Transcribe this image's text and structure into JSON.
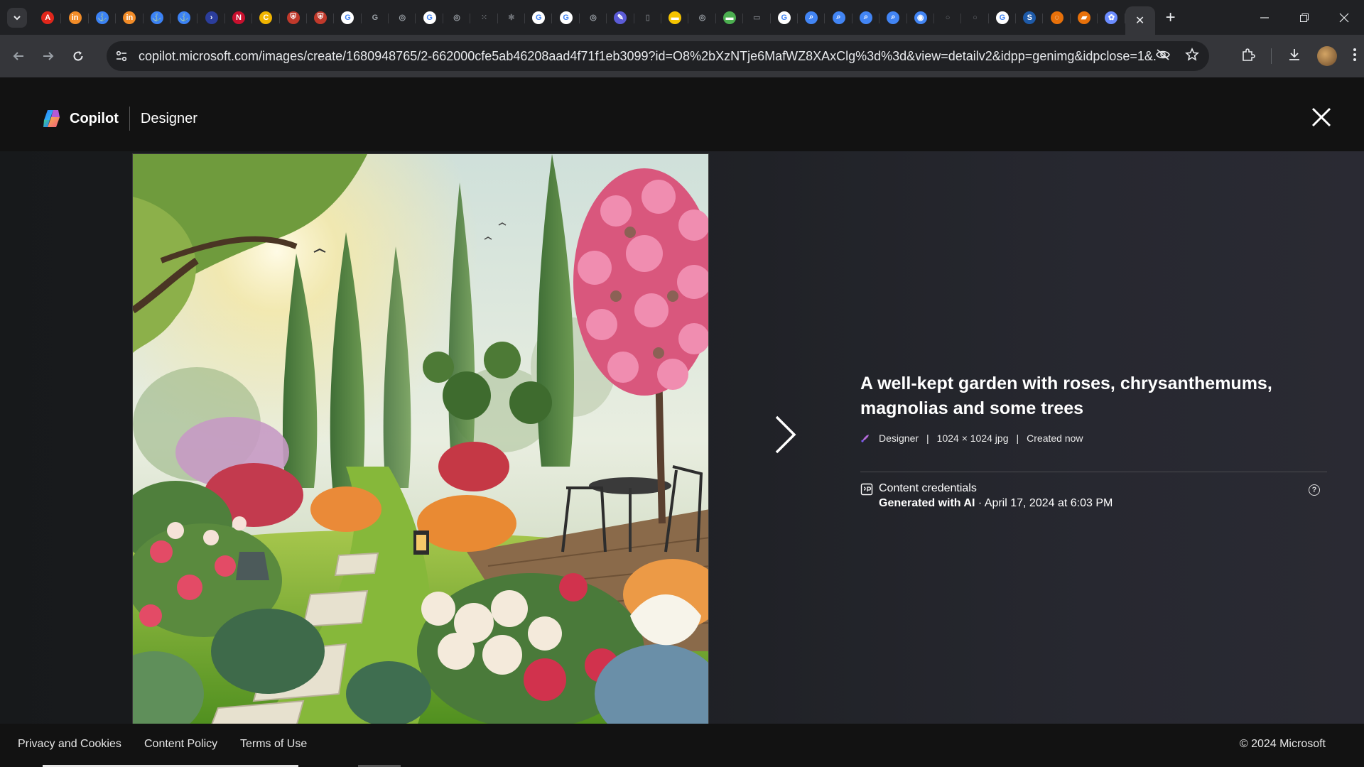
{
  "browser": {
    "url": "copilot.microsoft.com/images/create/1680948765/2-662000cfe5ab46208aad4f71f1eb3099?id=O8%2bXzNTje6MafWZ8XAxClg%3d%3d&view=detailv2&idpp=genimg&idpclose=1&...",
    "tab_favicons": [
      {
        "icon": "acrobat-icon",
        "color": "#e0261b",
        "glyph": "A"
      },
      {
        "icon": "app-icon",
        "color": "#f28c28",
        "glyph": "in"
      },
      {
        "icon": "anchor-icon",
        "color": "#3b82f6",
        "glyph": "⚓"
      },
      {
        "icon": "app-icon",
        "color": "#f28c28",
        "glyph": "in"
      },
      {
        "icon": "anchor-icon",
        "color": "#3b82f6",
        "glyph": "⚓"
      },
      {
        "icon": "anchor-icon",
        "color": "#3b82f6",
        "glyph": "⚓"
      },
      {
        "icon": "powershell-icon",
        "color": "#2b3d9b",
        "glyph": "›"
      },
      {
        "icon": "n-icon",
        "color": "#c8102e",
        "glyph": "N"
      },
      {
        "icon": "c-icon",
        "color": "#f0b400",
        "glyph": "C"
      },
      {
        "icon": "shield-icon",
        "color": "#c0392b",
        "glyph": "⛨"
      },
      {
        "icon": "shield-icon",
        "color": "#c0392b",
        "glyph": "⛨"
      },
      {
        "icon": "google-icon",
        "color": "#ffffff",
        "glyph": "G"
      },
      {
        "icon": "g-icon",
        "color": "#9aa0a6",
        "glyph": "G"
      },
      {
        "icon": "globe-icon",
        "color": "#9aa0a6",
        "glyph": "◎"
      },
      {
        "icon": "google-icon",
        "color": "#ffffff",
        "glyph": "G"
      },
      {
        "icon": "globe-icon",
        "color": "#9aa0a6",
        "glyph": "◎"
      },
      {
        "icon": "dots-icon",
        "color": "#3c3d41",
        "glyph": "⁙"
      },
      {
        "icon": "grid-icon",
        "color": "#3c3d41",
        "glyph": "✱"
      },
      {
        "icon": "google-icon",
        "color": "#ffffff",
        "glyph": "G"
      },
      {
        "icon": "google-icon",
        "color": "#ffffff",
        "glyph": "G"
      },
      {
        "icon": "globe-icon",
        "color": "#9aa0a6",
        "glyph": "◎"
      },
      {
        "icon": "copilot-icon",
        "color": "#5b5bd6",
        "glyph": "✎"
      },
      {
        "icon": "page-icon",
        "color": "#3c3d41",
        "glyph": "▯"
      },
      {
        "icon": "note-icon",
        "color": "#f5c400",
        "glyph": "▬"
      },
      {
        "icon": "globe-icon",
        "color": "#9aa0a6",
        "glyph": "◎"
      },
      {
        "icon": "bar-icon",
        "color": "#4caf50",
        "glyph": "▬"
      },
      {
        "icon": "blank-icon",
        "color": "#3c3d41",
        "glyph": "▭"
      },
      {
        "icon": "google-icon",
        "color": "#ffffff",
        "glyph": "G"
      },
      {
        "icon": "search-icon",
        "color": "#4285f4",
        "glyph": "⌕"
      },
      {
        "icon": "search-icon",
        "color": "#4285f4",
        "glyph": "⌕"
      },
      {
        "icon": "search-icon",
        "color": "#4285f4",
        "glyph": "⌕"
      },
      {
        "icon": "search-icon",
        "color": "#4285f4",
        "glyph": "⌕"
      },
      {
        "icon": "lens-icon",
        "color": "#4285f4",
        "glyph": "◉"
      },
      {
        "icon": "circle-icon",
        "color": "#3c3d41",
        "glyph": "○"
      },
      {
        "icon": "github-icon",
        "color": "#3c3d41",
        "glyph": "○"
      },
      {
        "icon": "google-icon",
        "color": "#ffffff",
        "glyph": "G"
      },
      {
        "icon": "sc-icon",
        "color": "#1e5aa8",
        "glyph": "S"
      },
      {
        "icon": "ring-icon",
        "color": "#e8710a",
        "glyph": "◌"
      },
      {
        "icon": "book-icon",
        "color": "#e8710a",
        "glyph": "▰"
      },
      {
        "icon": "copilot-icon",
        "color": "#6b8cff",
        "glyph": "✿"
      }
    ],
    "active_tab_close": "✕"
  },
  "header": {
    "brand": "Copilot",
    "product": "Designer"
  },
  "image": {
    "title": "A well-kept garden with roses, chrysanthemums, magnolias and some trees",
    "source": "Designer",
    "dimensions": "1024 × 1024 jpg",
    "created": "Created now",
    "credentials_title": "Content credentials",
    "credentials_generated": "Generated with AI",
    "credentials_date": " · April 17, 2024 at 6:03 PM"
  },
  "footer": {
    "privacy": "Privacy and Cookies",
    "policy": "Content Policy",
    "terms": "Terms of Use",
    "copyright": "© 2024 Microsoft"
  }
}
